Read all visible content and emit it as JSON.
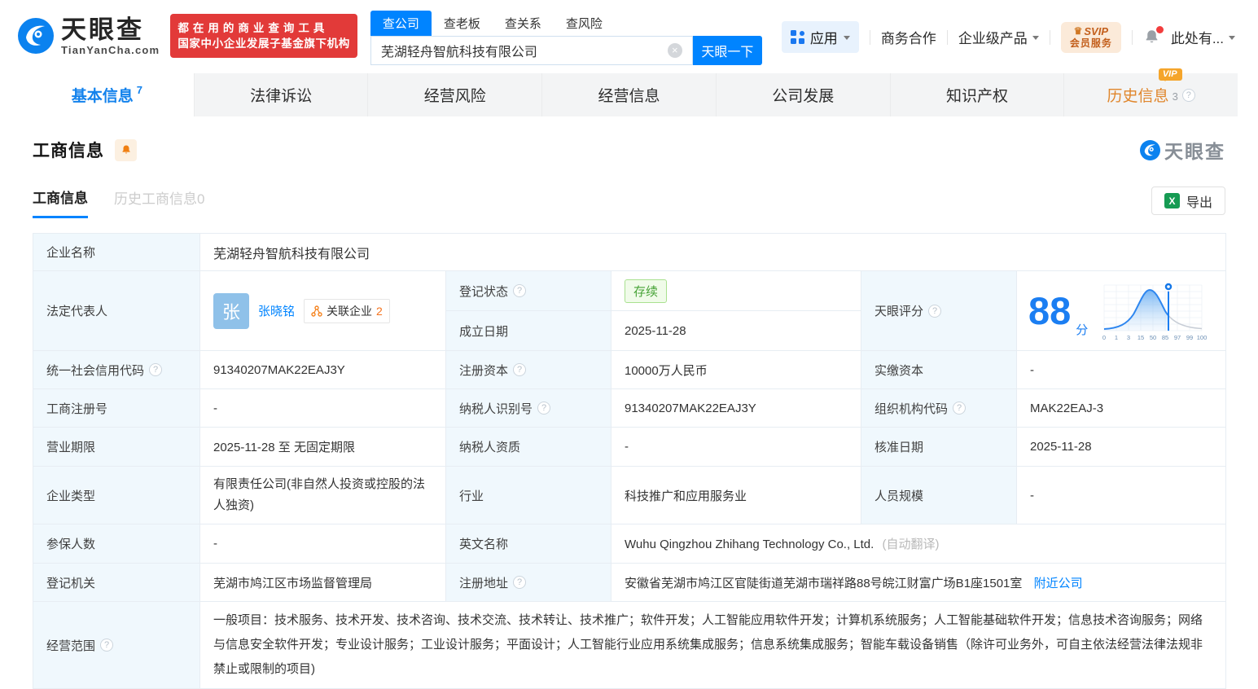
{
  "brand": {
    "name": "天眼查",
    "domain": "TianYanCha.com",
    "slogan1": "都在用的商业查询工具",
    "slogan2": "国家中小企业发展子基金旗下机构"
  },
  "search": {
    "tabs": [
      {
        "label": "查公司"
      },
      {
        "label": "查老板"
      },
      {
        "label": "查关系"
      },
      {
        "label": "查风险"
      }
    ],
    "value": "芜湖轻舟智航科技有限公司",
    "button": "天眼一下"
  },
  "topnav": {
    "apps": "应用",
    "biz_coop": "商务合作",
    "enterprise": "企业级产品",
    "svip_top": "SVIP",
    "svip_bottom": "会员服务",
    "more": "此处有..."
  },
  "tabs": [
    {
      "label": "基本信息",
      "count": "7"
    },
    {
      "label": "法律诉讼"
    },
    {
      "label": "经营风险"
    },
    {
      "label": "经营信息"
    },
    {
      "label": "公司发展"
    },
    {
      "label": "知识产权"
    },
    {
      "label": "历史信息",
      "count": "3",
      "vip": "VIP"
    }
  ],
  "section": {
    "title": "工商信息",
    "subtab_active": "工商信息",
    "subtab_history": "历史工商信息0",
    "export": "导出",
    "watermark": "天眼查"
  },
  "company": {
    "name_label": "企业名称",
    "name": "芜湖轻舟智航科技有限公司",
    "legal_rep_label": "法定代表人",
    "legal_rep_avatar": "张",
    "legal_rep": "张晓铭",
    "related_label": "关联企业",
    "related_count": "2",
    "reg_status_label": "登记状态",
    "reg_status": "存续",
    "est_date_label": "成立日期",
    "est_date": "2025-11-28",
    "score_label": "天眼评分",
    "score": "88",
    "score_unit": "分",
    "credit_code_label": "统一社会信用代码",
    "credit_code": "91340207MAK22EAJ3Y",
    "reg_capital_label": "注册资本",
    "reg_capital": "10000万人民币",
    "paid_capital_label": "实缴资本",
    "paid_capital": "-",
    "reg_number_label": "工商注册号",
    "reg_number": "-",
    "taxpayer_id_label": "纳税人识别号",
    "taxpayer_id": "91340207MAK22EAJ3Y",
    "org_code_label": "组织机构代码",
    "org_code": "MAK22EAJ-3",
    "business_term_label": "营业期限",
    "business_term": "2025-11-28 至 无固定期限",
    "taxpayer_quality_label": "纳税人资质",
    "taxpayer_quality": "-",
    "approval_date_label": "核准日期",
    "approval_date": "2025-11-28",
    "company_type_label": "企业类型",
    "company_type": "有限责任公司(非自然人投资或控股的法人独资)",
    "industry_label": "行业",
    "industry": "科技推广和应用服务业",
    "staff_size_label": "人员规模",
    "staff_size": "-",
    "insured_label": "参保人数",
    "insured": "-",
    "english_name_label": "英文名称",
    "english_name": "Wuhu Qingzhou Zhihang Technology Co., Ltd.",
    "english_name_note": "(自动翻译)",
    "reg_authority_label": "登记机关",
    "reg_authority": "芜湖市鸠江区市场监督管理局",
    "address_label": "注册地址",
    "address": "安徽省芜湖市鸠江区官陡街道芜湖市瑞祥路88号皖江财富广场B1座1501室",
    "address_link": "附近公司",
    "business_scope_label": "经营范围",
    "business_scope": "一般项目：技术服务、技术开发、技术咨询、技术交流、技术转让、技术推广；软件开发；人工智能应用软件开发；计算机系统服务；人工智能基础软件开发；信息技术咨询服务；网络与信息安全软件开发；专业设计服务；工业设计服务；平面设计；人工智能行业应用系统集成服务；信息系统集成服务；智能车载设备销售（除许可业务外，可自主依法经营法律法规非禁止或限制的项目)"
  },
  "score_chart": {
    "type": "area",
    "title": "天眼评分分布曲线",
    "score_value": 88,
    "ticks": [
      "0",
      "1",
      "3",
      "15",
      "50",
      "85",
      "97",
      "99",
      "100"
    ],
    "marker_at_tick": "85-97区间",
    "xlim": [
      0,
      100
    ]
  },
  "icons": {
    "question": "?",
    "clear": "×",
    "excel_x": "X",
    "crown": "♛"
  },
  "colors": {
    "accent": "#0084ff",
    "banner_red": "#e23a39",
    "status_green": "#47a337",
    "vip_orange": "#f5a52b",
    "score_blue": "#1b7ef2"
  }
}
